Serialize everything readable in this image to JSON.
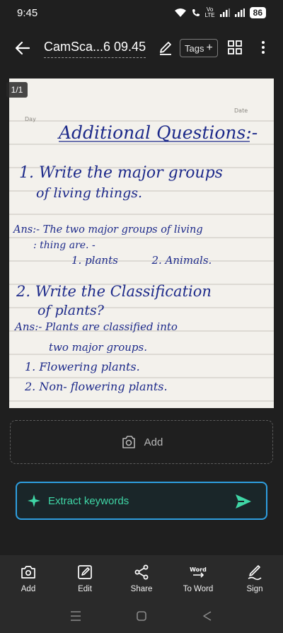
{
  "status_bar": {
    "time": "9:45",
    "network_label_top": "Vo",
    "network_label_bottom": "LTE",
    "battery": "86"
  },
  "app_bar": {
    "title": "CamSca...6 09.45",
    "tags_label": "Tags",
    "tags_plus": "+"
  },
  "page": {
    "counter": "1/1",
    "header_left": "Day",
    "header_right": "Date",
    "lines": [
      "Additional Questions:-",
      "1. Write the major groups",
      "of living things.",
      "Ans:- The two major groups of living",
      ": thing are. -",
      "1. plants          2. Animals.",
      "2. Write the Classification",
      "of plants?",
      "Ans:- Plants are classified into",
      "two major groups.",
      "1. Flowering plants.",
      "2. Non- flowering plants."
    ]
  },
  "add_area": {
    "label": "Add"
  },
  "extract": {
    "label": "Extract keywords"
  },
  "toolbar": {
    "items": [
      {
        "label": "Add",
        "icon": "add-photo-icon"
      },
      {
        "label": "Edit",
        "icon": "edit-icon"
      },
      {
        "label": "Share",
        "icon": "share-icon"
      },
      {
        "label": "To Word",
        "icon": "word-icon",
        "icon_text": "Word"
      },
      {
        "label": "Sign",
        "icon": "signature-icon"
      }
    ]
  },
  "colors": {
    "background": "#1f1f1f",
    "accent_green": "#3fd6a6",
    "accent_blue": "#2e9fe0",
    "ink": "#1d2a8a"
  }
}
